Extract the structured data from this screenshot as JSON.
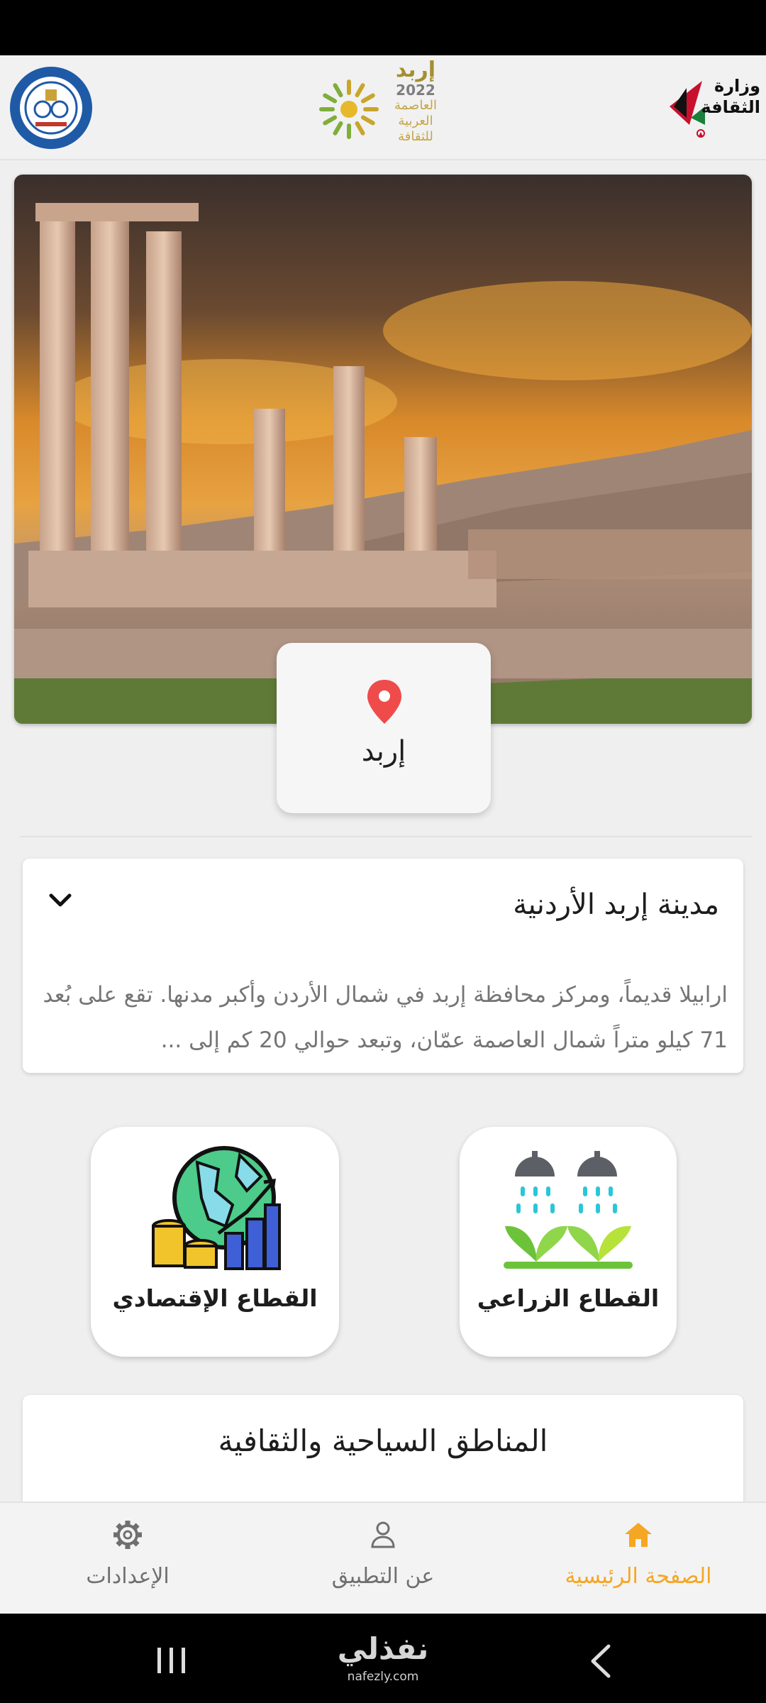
{
  "header": {
    "capital_logo": {
      "city": "إربد",
      "year": "2022",
      "line1": "العاصمة",
      "line2": "العربية",
      "line3": "للثقافة"
    },
    "ministry_logo": {
      "line1": "وزارة",
      "line2": "الثقافة"
    }
  },
  "hero": {
    "location_name": "إربد"
  },
  "about": {
    "title": "مدينة إربد الأردنية",
    "text": "ارابيلا قديماً، ومركز محافظة إربد في شمال الأردن وأكبر مدنها. تقع على بُعد 71 كيلو متراً شمال العاصمة عمّان، وتبعد حوالي 20 كم إلى ..."
  },
  "sectors": [
    {
      "label": "القطاع الإقتصادي",
      "icon": "economy-globe-chart-icon"
    },
    {
      "label": "القطاع الزراعي",
      "icon": "irrigation-plants-icon"
    }
  ],
  "tourism": {
    "title": "المناطق السياحية والثقافية"
  },
  "bottom_nav": {
    "home": "الصفحة الرئيسية",
    "about_app": "عن التطبيق",
    "settings": "الإعدادات",
    "active": "home",
    "active_color": "#f5a623",
    "inactive_color": "#6f6f6f"
  },
  "watermark": {
    "arabic": "نفذلي",
    "latin": "nafezly.com"
  }
}
